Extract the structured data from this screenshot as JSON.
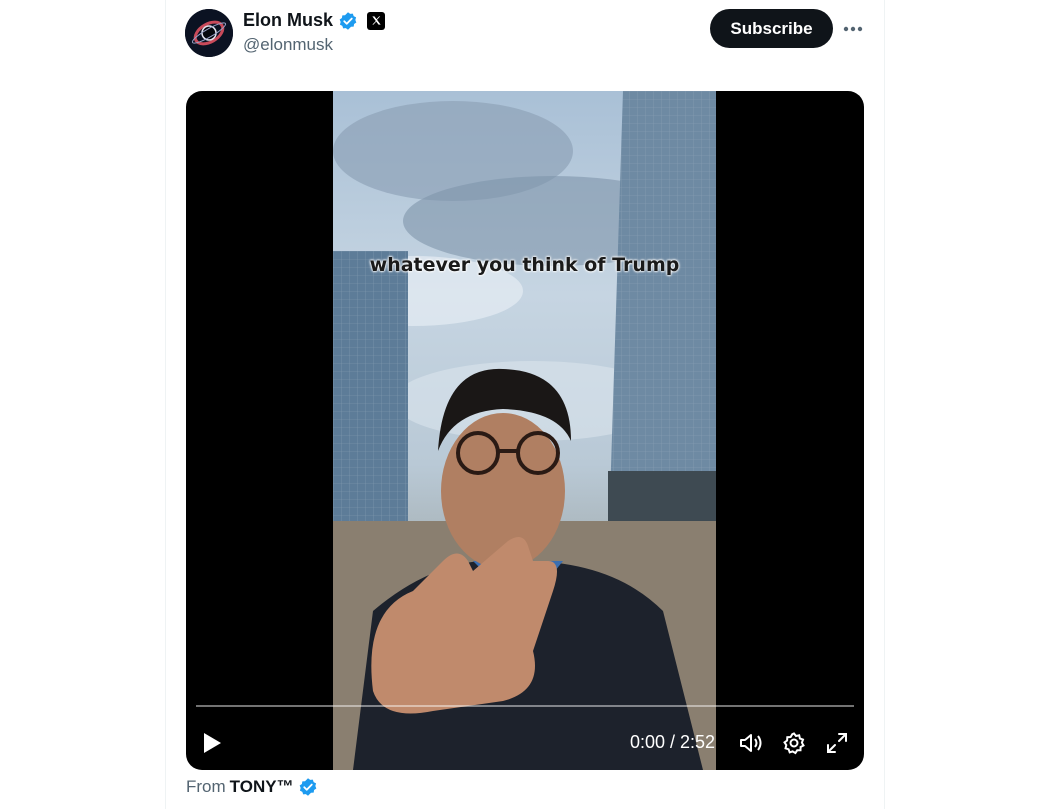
{
  "post": {
    "author_name": "Elon Musk",
    "author_handle": "@elonmusk",
    "verified_icon": "verified-badge-icon",
    "affiliate_icon": "x-logo-icon",
    "subscribe_label": "Subscribe",
    "more_icon": "more-horizontal-icon"
  },
  "video": {
    "caption": "whatever you think of Trump",
    "time": "0:00 / 2:52",
    "progress": 0,
    "controls": [
      "play-icon",
      "volume-icon",
      "settings-icon",
      "fullscreen-icon"
    ]
  },
  "attribution": {
    "prefix": "From",
    "source_name": "TONY™"
  },
  "colors": {
    "verified_blue": "#1d9bf0",
    "text_primary": "#0f1419",
    "text_secondary": "#536471",
    "subscribe_bg": "#0f1419"
  }
}
